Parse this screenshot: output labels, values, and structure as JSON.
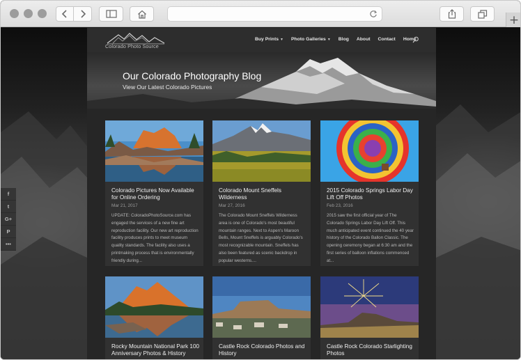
{
  "browser": {
    "icons": [
      "back-icon",
      "forward-icon",
      "sidebar-icon",
      "home-icon",
      "reload-icon",
      "share-icon",
      "tabs-icon",
      "new-tab-icon"
    ]
  },
  "site": {
    "logo_text": "Colorado Photo Source",
    "nav": [
      {
        "label": "Buy Prints",
        "has_caret": true
      },
      {
        "label": "Photo Galleries",
        "has_caret": true
      },
      {
        "label": "Blog",
        "has_caret": false
      },
      {
        "label": "About",
        "has_caret": false
      },
      {
        "label": "Contact",
        "has_caret": false
      },
      {
        "label": "Home",
        "has_caret": false
      }
    ],
    "hero": {
      "title": "Our Colorado Photography Blog",
      "subtitle": "View Our Latest Colorado Pictures"
    },
    "posts": [
      {
        "title": "Colorado Pictures Now Available for Online Ordering",
        "date": "Mar 21, 2017",
        "excerpt": "UPDATE: ColoradoPhotoSource.com has engaged the services of a new fine art reproduction facility. Our new art reproduction facility produces prints to meet museum quality standards. The facility also uses a printmaking process that is environmentally friendly during..."
      },
      {
        "title": "Colorado Mount Sneffels Wilderness",
        "date": "Mar 27, 2016",
        "excerpt": "The Colorado Mount Sneffels Wilderness area is one of Colorado's most beautiful mountain ranges. Next to Aspen's Maroon Bells, Mount Sneffels is arguably Colorado's most recognizable mountain. Sneffels has also been featured as scenic backdrop in popular westerns...."
      },
      {
        "title": "2015 Colorado Springs Labor Day Lift Off Photos",
        "date": "Feb 23, 2016",
        "excerpt": "2015 saw the first official year of The Colorado Springs Labor Day Lift Off. This much anticipated event continued the 40 year history of the Colorado Ballon Classic. The opening ceremony began at 6:30 am and the first series of balloon inflations commenced at..."
      },
      {
        "title": "Rocky Mountain National Park 100 Anniversary Photos & History",
        "date": "",
        "excerpt": ""
      },
      {
        "title": "Castle Rock Colorado Photos and History",
        "date": "",
        "excerpt": ""
      },
      {
        "title": "Castle Rock Colorado Starlighting Photos",
        "date": "",
        "excerpt": ""
      }
    ],
    "share": [
      "f",
      "t",
      "G+",
      "P",
      "•••"
    ]
  },
  "colors": {
    "site_bg": "#262626",
    "card_bg": "#313131",
    "accent_text": "#ffffff"
  }
}
